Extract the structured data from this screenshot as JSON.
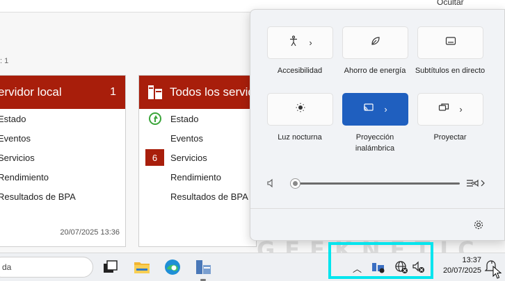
{
  "server_manager": {
    "hide_label": "Ocultar",
    "roles_count": ": 1",
    "tiles": [
      {
        "title": "ervidor local",
        "count": "1",
        "rows": [
          "Estado",
          "Eventos",
          "Servicios",
          "Rendimiento",
          "Resultados de BPA"
        ],
        "timestamp": "20/07/2025 13:36"
      },
      {
        "title": "Todos los servido",
        "rows": [
          "Estado",
          "Eventos",
          "Servicios",
          "Rendimiento",
          "Resultados de BPA"
        ],
        "badge": "6"
      }
    ]
  },
  "quick_settings": {
    "buttons": [
      {
        "label": "Accesibilidad",
        "icon": "accessibility-icon",
        "active": false,
        "has_chevron": true
      },
      {
        "label": "Ahorro de energía",
        "icon": "leaf-icon",
        "active": false,
        "has_chevron": false
      },
      {
        "label": "Subtítulos en directo",
        "icon": "captions-icon",
        "active": false,
        "has_chevron": false
      },
      {
        "label": "Luz nocturna",
        "icon": "night-light-icon",
        "active": false,
        "has_chevron": false
      },
      {
        "label": "Proyección inalámbrica",
        "icon": "cast-icon",
        "active": true,
        "has_chevron": true
      },
      {
        "label": "Proyectar",
        "icon": "project-icon",
        "active": false,
        "has_chevron": true
      }
    ],
    "volume_level": 0.0,
    "accent_color": "#1f5fbf"
  },
  "taskbar": {
    "search_text": "da",
    "clock_time": "13:37",
    "clock_date": "20/07/2025",
    "highlight_color": "#00e5ee"
  },
  "watermark": "GEEKNETIC"
}
